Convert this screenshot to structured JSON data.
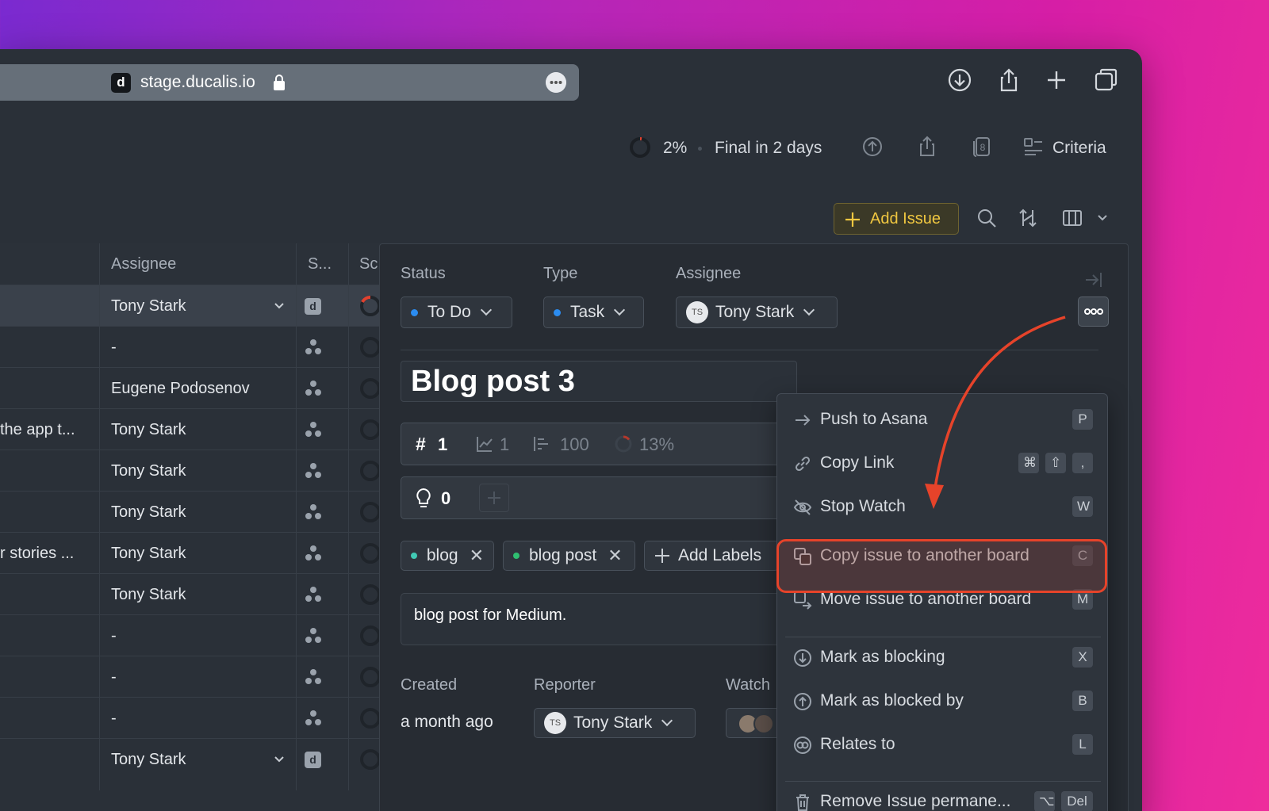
{
  "browser": {
    "favicon_letter": "d",
    "url": "stage.ducalis.io"
  },
  "header": {
    "progress": "2%",
    "final_text": "Final in 2 days",
    "badge_count": "8",
    "criteria_label": "Criteria",
    "add_issue_label": "Add Issue"
  },
  "table": {
    "col_assignee": "Assignee",
    "col_s": "S...",
    "col_sc": "Sc",
    "rows": [
      {
        "left": "",
        "assignee": "Tony Stark",
        "selected": true
      },
      {
        "left": "",
        "assignee": "-"
      },
      {
        "left": "",
        "assignee": "Eugene Podosenov"
      },
      {
        "left": "the app t...",
        "assignee": "Tony Stark"
      },
      {
        "left": "",
        "assignee": "Tony Stark"
      },
      {
        "left": "",
        "assignee": "Tony Stark"
      },
      {
        "left": "r stories ...",
        "assignee": "Tony Stark"
      },
      {
        "left": "",
        "assignee": "Tony Stark"
      },
      {
        "left": "",
        "assignee": "-"
      },
      {
        "left": "",
        "assignee": "-"
      },
      {
        "left": "",
        "assignee": "-"
      },
      {
        "left": "",
        "assignee": "Tony Stark"
      }
    ]
  },
  "panel": {
    "status_label": "Status",
    "status_value": "To Do",
    "type_label": "Type",
    "type_value": "Task",
    "assignee_label": "Assignee",
    "assignee_initials": "TS",
    "assignee_value": "Tony Stark",
    "title": "Blog post 3",
    "issue_number": "1",
    "stat_votes": "1",
    "stat_score": "100",
    "stat_percent": "13%",
    "ideas_count": "0",
    "labels": [
      {
        "name": "blog",
        "color": "#41c9b4"
      },
      {
        "name": "blog post",
        "color": "#2fbf71"
      }
    ],
    "add_labels": "Add Labels",
    "description": "blog post for Medium.",
    "created_label": "Created",
    "created_value": "a month ago",
    "reporter_label": "Reporter",
    "reporter_initials": "TS",
    "reporter_value": "Tony Stark",
    "watchers_label": "Watch"
  },
  "menu": {
    "items": [
      {
        "label": "Push to Asana",
        "keys": [
          "P"
        ]
      },
      {
        "label": "Copy Link",
        "keys": [
          "⌘",
          "⇧",
          ","
        ]
      },
      {
        "label": "Stop Watch",
        "keys": [
          "W"
        ]
      },
      {
        "label": "Copy issue to another board",
        "keys": [
          "C"
        ]
      },
      {
        "label": "Move issue to another board",
        "keys": [
          "M"
        ]
      },
      {
        "label": "Mark as blocking",
        "keys": [
          "X"
        ]
      },
      {
        "label": "Mark as blocked by",
        "keys": [
          "B"
        ]
      },
      {
        "label": "Relates to",
        "keys": [
          "L"
        ]
      },
      {
        "label": "Remove Issue permane...",
        "keys": [
          "⌥",
          "Del"
        ]
      }
    ]
  },
  "colors": {
    "highlight": "#e6432a",
    "accent_yellow": "#f0c740",
    "status_dot": "#2b8cf0"
  }
}
